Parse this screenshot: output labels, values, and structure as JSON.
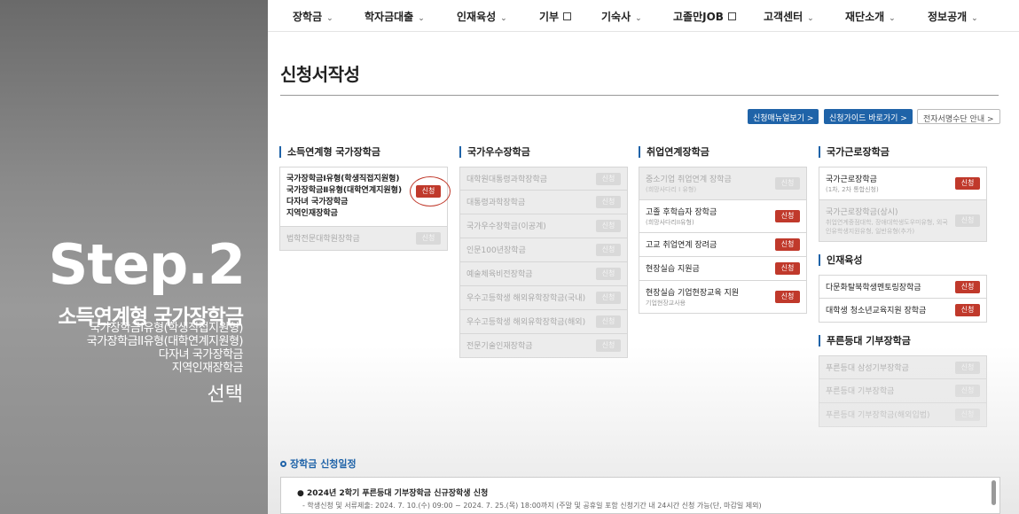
{
  "overlay": {
    "step": "Step.2",
    "subtitle": "소득연계형 국가장학금",
    "lines": [
      "국가장학금I유형(학생직접지원형)",
      "국가장학금II유형(대학연계지원형)",
      "다자녀 국가장학금",
      "지역인재장학금"
    ],
    "select": "선택"
  },
  "nav": [
    {
      "label": "장학금",
      "icon": "chevron-down-icon"
    },
    {
      "label": "학자금대출",
      "icon": "chevron-down-icon"
    },
    {
      "label": "인재육성",
      "icon": "chevron-down-icon"
    },
    {
      "label": "기부",
      "icon": "external-link-icon"
    },
    {
      "label": "기숙사",
      "icon": "chevron-down-icon"
    },
    {
      "label": "고졸만JOB",
      "icon": "external-link-icon"
    },
    {
      "label": "고객센터",
      "icon": "chevron-down-icon"
    },
    {
      "label": "재단소개",
      "icon": "chevron-down-icon"
    },
    {
      "label": "정보공개",
      "icon": "chevron-down-icon"
    }
  ],
  "page_title": "신청서작성",
  "top_buttons": [
    "신청매뉴얼보기 >",
    "신청가이드 바로가기 >",
    "전자서명수단 안내 >"
  ],
  "apply_label": "신청",
  "columns": {
    "c1": {
      "head": "소득연계형 국가장학금",
      "multi": [
        "국가장학금Ⅰ유형(학생직접지원형)",
        "국가장학금Ⅱ유형(대학연계지원형)",
        "다자녀 국가장학금",
        "지역인재장학금"
      ],
      "items": [
        {
          "label": "법학전문대학원장학금",
          "sub": "",
          "enabled": false
        }
      ]
    },
    "c2": {
      "head": "국가우수장학금",
      "items": [
        {
          "label": "대학원대통령과학장학금",
          "enabled": false
        },
        {
          "label": "대통령과학장학금",
          "enabled": false
        },
        {
          "label": "국가우수장학금(이공계)",
          "enabled": false
        },
        {
          "label": "인문100년장학금",
          "enabled": false
        },
        {
          "label": "예술체육비전장학금",
          "enabled": false
        },
        {
          "label": "우수고등학생 해외유학장학금(국내)",
          "enabled": false
        },
        {
          "label": "우수고등학생 해외유학장학금(해외)",
          "enabled": false
        },
        {
          "label": "전문기술인재장학금",
          "enabled": false
        }
      ]
    },
    "c3": {
      "head": "취업연계장학금",
      "items": [
        {
          "label": "중소기업 취업연계 장학금",
          "sub": "(희망사다리 I 유형)",
          "enabled": false
        },
        {
          "label": "고졸 후학습자 장학금",
          "sub": "(희망사다리II유형)",
          "enabled": true
        },
        {
          "label": "고교 취업연계 장려금",
          "sub": "",
          "enabled": true
        },
        {
          "label": "현장실습 지원금",
          "sub": "",
          "enabled": true
        },
        {
          "label": "현장실습 기업현장교육 지원",
          "sub": "기업현장교사용",
          "enabled": true
        }
      ]
    },
    "c4": {
      "head": "국가근로장학금",
      "items": [
        {
          "label": "국가근로장학금",
          "sub": "(1차, 2차 통합신청)",
          "enabled": true
        },
        {
          "label": "국가근로장학금(상시)",
          "sub": "취업연계중점대학, 장애대학생도우미유형, 외국인유학생지원유형, 일반유형(추가)",
          "enabled": false
        }
      ],
      "head2": "인재육성",
      "items2": [
        {
          "label": "다문화탈북학생멘토링장학금",
          "enabled": true
        },
        {
          "label": "대학생 청소년교육지원 장학금",
          "enabled": true
        }
      ],
      "head3": "푸른등대 기부장학금",
      "items3": [
        {
          "label": "푸른등대 삼성기부장학금",
          "enabled": false
        },
        {
          "label": "푸른등대 기부장학금",
          "enabled": false
        },
        {
          "label": "푸른등대 기부장학금(해외입법)",
          "enabled": false
        }
      ]
    }
  },
  "schedule": {
    "title": "장학금 신청일정",
    "line1": "● 2024년 2학기 푸른등대 기부장학금 신규장학생 신청",
    "line2": "- 학생신청 및 서류제출: 2024. 7. 10.(수) 09:00 ~ 2024. 7. 25.(목) 18:00까지 (주말 및 공휴일 포함 신청기간 내 24시간 신청 가능(단, 마감일 제외)"
  },
  "colors": {
    "accent": "#1f63a8",
    "apply": "#c0392b",
    "disabled_bg": "#ececec"
  }
}
